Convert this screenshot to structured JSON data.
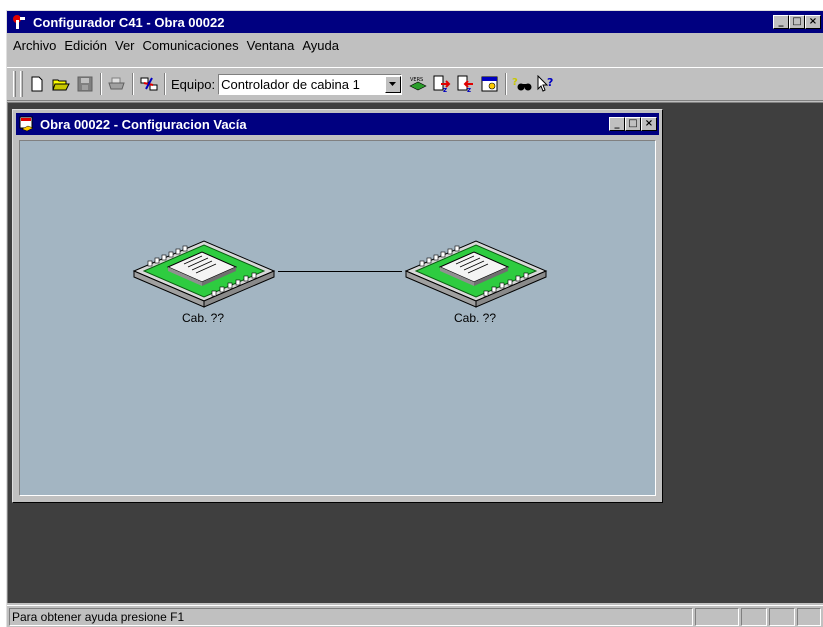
{
  "window": {
    "title": "Configurador C41 - Obra 00022",
    "minimize": "_",
    "maximize": "□",
    "close": "×"
  },
  "menu": [
    {
      "label": "Archivo"
    },
    {
      "label": "Edición"
    },
    {
      "label": "Ver"
    },
    {
      "label": "Comunicaciones"
    },
    {
      "label": "Ventana"
    },
    {
      "label": "Ayuda"
    }
  ],
  "toolbar": {
    "equipo_label": "Equipo:",
    "equipo_value": "Controlador de cabina 1",
    "vers_label": "VERS",
    "help_glyph": "?"
  },
  "child_window": {
    "title": "Obra 00022 - Configuracion Vacía",
    "minimize": "_",
    "maximize": "□",
    "close": "×",
    "nodes": [
      {
        "label": "Cab. ??"
      },
      {
        "label": "Cab. ??"
      }
    ]
  },
  "statusbar": {
    "text": "Para obtener ayuda presione F1"
  },
  "colors": {
    "title_bg": "#000080",
    "canvas_bg": "#a3b5c2",
    "mdi_bg": "#3f3f3f",
    "board_green": "#2ecc40"
  }
}
